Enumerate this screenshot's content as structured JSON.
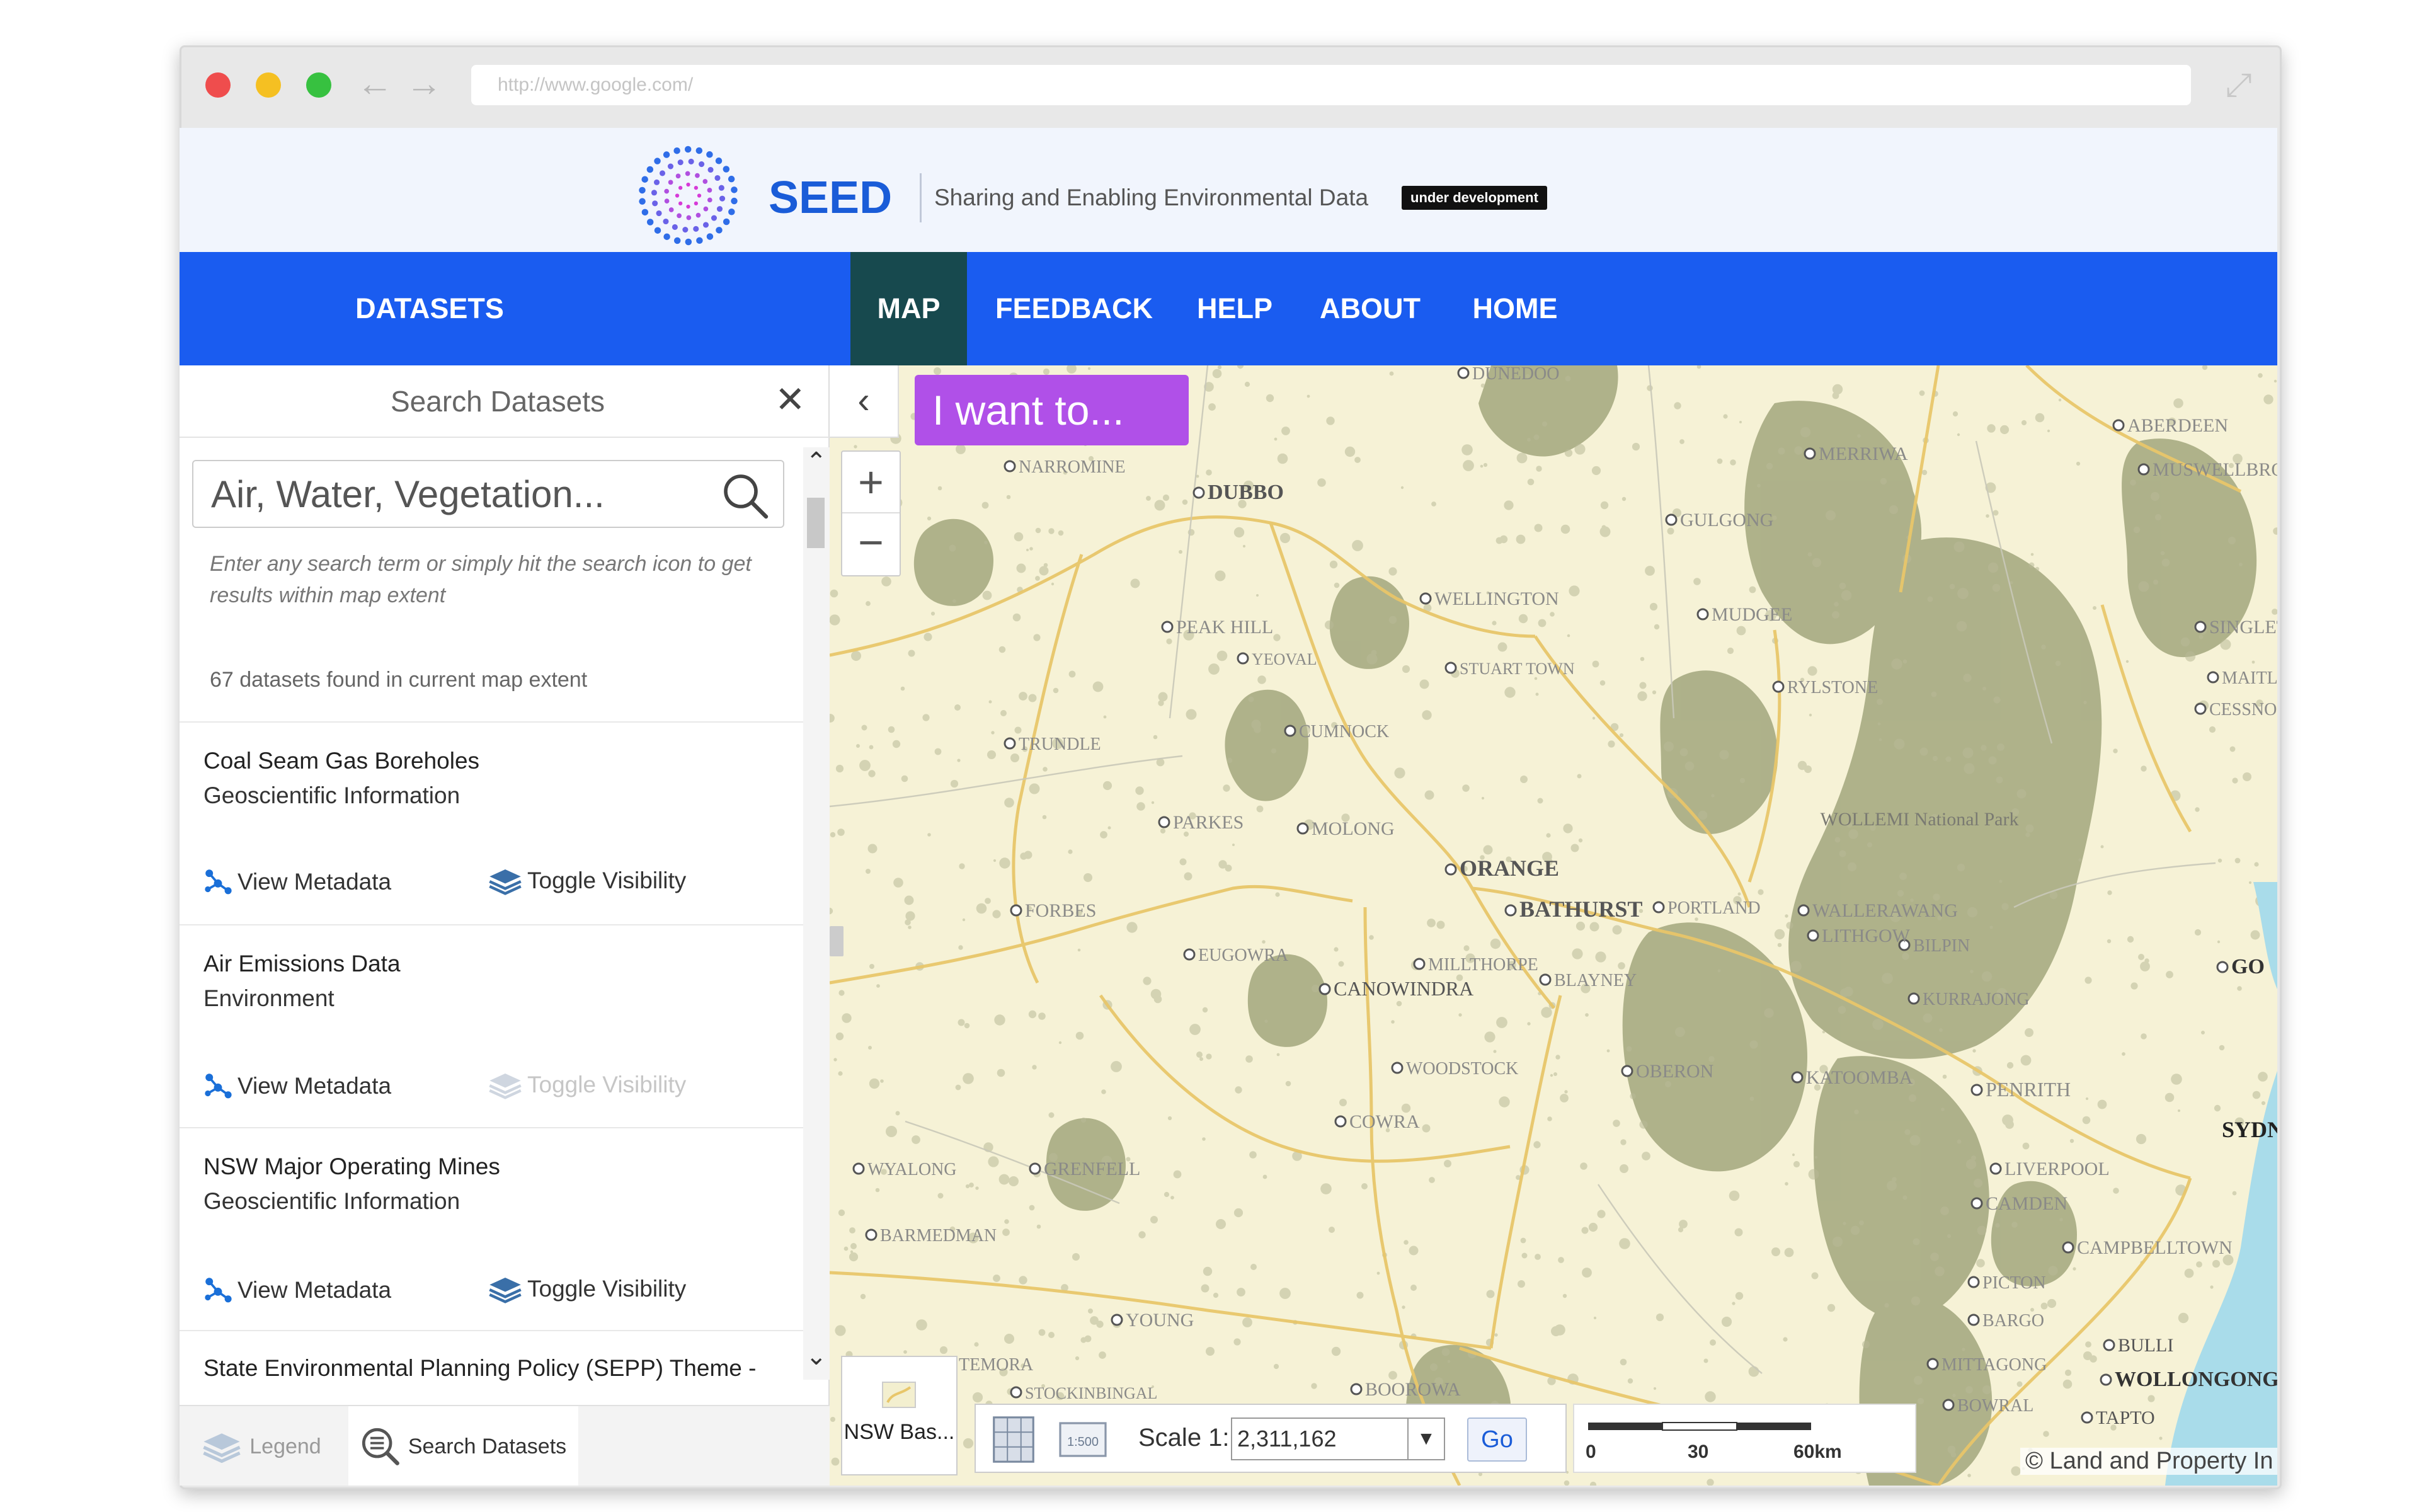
{
  "browser": {
    "url": "http://www.google.com/"
  },
  "header": {
    "brand": "SEED",
    "tagline": "Sharing and Enabling Environmental Data",
    "badge": "under development"
  },
  "nav": {
    "items": [
      {
        "label": "DATASETS"
      },
      {
        "label": "MAP",
        "active": true
      },
      {
        "label": "FEEDBACK"
      },
      {
        "label": "HELP"
      },
      {
        "label": "ABOUT"
      },
      {
        "label": "HOME"
      }
    ]
  },
  "sidebar": {
    "title": "Search Datasets",
    "search_placeholder": "Air, Water, Vegetation...",
    "hint": "Enter any search term or simply hit the search icon to get results within map extent",
    "count_text": "67 datasets found in current map extent",
    "datasets": [
      {
        "title": "Coal Seam Gas Boreholes",
        "category": "Geoscientific Information",
        "meta_label": "View Metadata",
        "visibility_label": "Toggle Visibility",
        "visibility_enabled": true
      },
      {
        "title": "Air Emissions Data",
        "category": "Environment",
        "meta_label": "View Metadata",
        "visibility_label": "Toggle Visibility",
        "visibility_enabled": false
      },
      {
        "title": "NSW Major Operating Mines",
        "category": "Geoscientific Information",
        "meta_label": "View Metadata",
        "visibility_label": "Toggle Visibility",
        "visibility_enabled": true
      },
      {
        "title": "State Environmental Planning Policy (SEPP) Theme -",
        "category": "",
        "meta_label": "",
        "visibility_label": "",
        "visibility_enabled": true
      }
    ],
    "footer": {
      "legend": "Legend",
      "search": "Search Datasets"
    }
  },
  "map": {
    "i_want_to": "I want to...",
    "basemap_label": "NSW Bas...",
    "scale_label": "Scale 1:",
    "scale_value": "2,311,162",
    "go": "Go",
    "scalebar_ticks": [
      "0",
      "30",
      "60km"
    ],
    "copyright": "© Land and Property In",
    "places": {
      "dunedoo": "DUNEDOO",
      "aberdeen": "ABERDEEN",
      "narromine": "NARROMINE",
      "dubbo": "DUBBO",
      "merriwa": "MERRIWA",
      "muswellbrook": "MUSWELLBROOK",
      "gulgong": "GULGONG",
      "wellington": "WELLINGTON",
      "mudgee": "MUDGEE",
      "singleton": "SINGLETO",
      "peak_hill": "PEAK HILL",
      "yeoval": "YEOVAL",
      "stuart_town": "STUART TOWN",
      "ryistone": "RYLSTONE",
      "maitland": "MAITL",
      "cessnock": "CESSNOCK",
      "trundle": "TRUNDLE",
      "cumnock": "CUMNOCK",
      "parkes": "PARKES",
      "molong": "MOLONG",
      "wollemi": "WOLLEMI National Park",
      "orange": "ORANGE",
      "bathurst": "BATHURST",
      "portland": "PORTLAND",
      "wallerawang": "WALLERAWANG",
      "lithgow": "LITHGOW",
      "bilpin": "BILPIN",
      "forbes": "FORBES",
      "eugowra": "EUGOWRA",
      "millthorpe": "MILLTHORPE",
      "blayney": "BLAYNEY",
      "canowindra": "CANOWINDRA",
      "kurrajong": "KURRAJONG",
      "katoomba": "KATOOMBA",
      "penrith": "PENRITH",
      "woodstock": "WOODSTOCK",
      "oberon": "OBERON",
      "sydney": "SYDNE",
      "cowra": "COWRA",
      "grenfell": "GRENFELL",
      "wyalong": "WYALONG",
      "liverpool": "LIVERPOOL",
      "camden": "CAMDEN",
      "barmedman": "BARMEDMAN",
      "campbelltown": "CAMPBELLTOWN",
      "picton": "PICTON",
      "young": "YOUNG",
      "bargo": "BARGO",
      "bulli": "BULLI",
      "temora": "TEMORA",
      "stockinbingal": "STOCKINBINGAL",
      "boorowa": "BOOROWA",
      "mittagong": "MITTAGONG",
      "bowral": "BOWRAL",
      "wollongong": "WOLLONGONG",
      "tapto": "TAPTO",
      "go": "GO"
    }
  },
  "colors": {
    "nav_blue": "#1a5cf0",
    "nav_active": "#17494e",
    "brand_blue": "#1a5cd8",
    "iwant_purple": "#b050e8",
    "map_base": "#f6f2d6",
    "forest": "#a7ab82",
    "road": "#e8c66a"
  },
  "icons": [
    "search-icon",
    "close-icon",
    "chevron-left-icon",
    "zoom-in-icon",
    "zoom-out-icon",
    "metadata-icon",
    "layers-icon",
    "legend-icon",
    "search-datasets-icon"
  ]
}
